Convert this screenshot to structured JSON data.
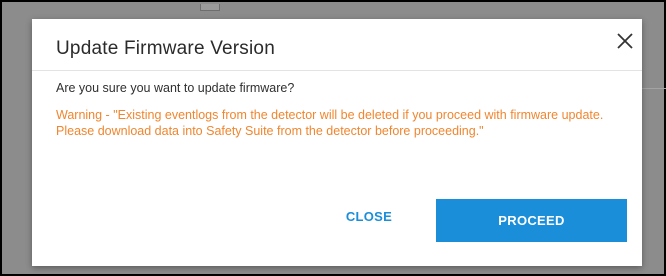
{
  "dialog": {
    "title": "Update Firmware Version",
    "close_icon": "close-icon",
    "question": "Are you sure you want to update firmware?",
    "warning": "Warning - \"Existing eventlogs from the detector will be deleted if you proceed with firmware update. Please download data into Safety Suite from the detector before proceeding.\"",
    "cancel_label": "CLOSE",
    "confirm_label": "PROCEED"
  },
  "colors": {
    "accent": "#1a8ed9",
    "warning_text": "#f0862f",
    "title_text": "#2b2b2b",
    "overlay": "#8c8c8c"
  }
}
